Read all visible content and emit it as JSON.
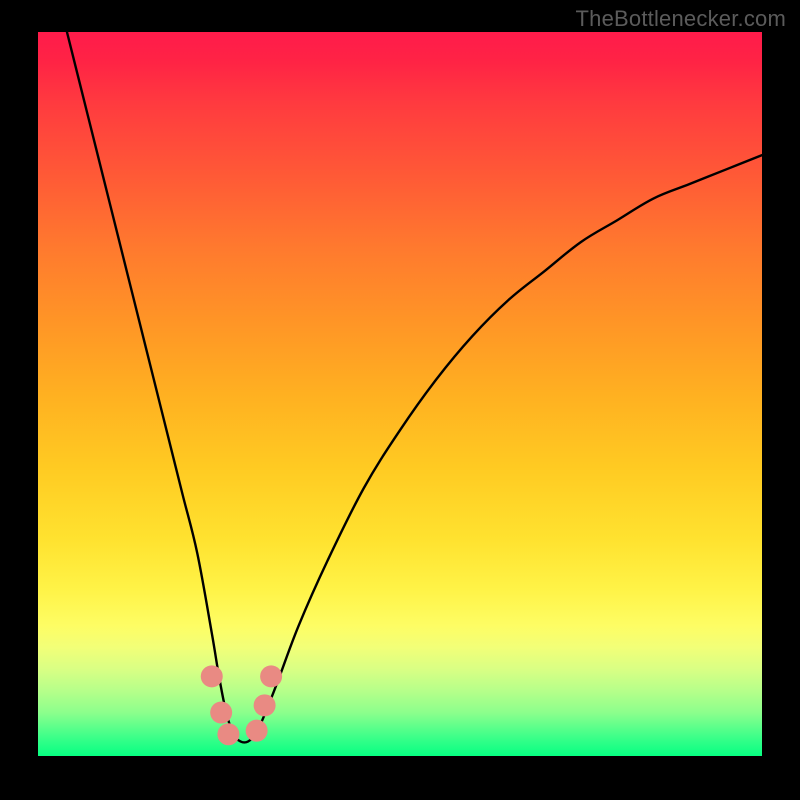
{
  "watermark": "TheBottlenecker.com",
  "chart_data": {
    "type": "line",
    "title": "",
    "xlabel": "",
    "ylabel": "",
    "xlim": [
      0,
      100
    ],
    "ylim": [
      0,
      100
    ],
    "grid": false,
    "legend": false,
    "series": [
      {
        "name": "bottleneck-curve",
        "color": "#000000",
        "x": [
          4,
          6,
          8,
          10,
          12,
          14,
          16,
          18,
          20,
          22,
          24,
          25,
          26,
          27,
          28,
          29,
          30,
          31,
          33,
          36,
          40,
          45,
          50,
          55,
          60,
          65,
          70,
          75,
          80,
          85,
          90,
          95,
          100
        ],
        "y": [
          100,
          92,
          84,
          76,
          68,
          60,
          52,
          44,
          36,
          28,
          17,
          11,
          6,
          3,
          2,
          2,
          3,
          5,
          10,
          18,
          27,
          37,
          45,
          52,
          58,
          63,
          67,
          71,
          74,
          77,
          79,
          81,
          83
        ]
      }
    ],
    "markers": [
      {
        "x": 24.0,
        "y": 11.0,
        "color": "#e98a83"
      },
      {
        "x": 25.3,
        "y": 6.0,
        "color": "#e98a83"
      },
      {
        "x": 26.3,
        "y": 3.0,
        "color": "#e98a83"
      },
      {
        "x": 30.2,
        "y": 3.5,
        "color": "#e98a83"
      },
      {
        "x": 31.3,
        "y": 7.0,
        "color": "#e98a83"
      },
      {
        "x": 32.2,
        "y": 11.0,
        "color": "#e98a83"
      }
    ]
  },
  "colors": {
    "curve": "#000000",
    "marker": "#e98a83",
    "frame": "#000000"
  }
}
